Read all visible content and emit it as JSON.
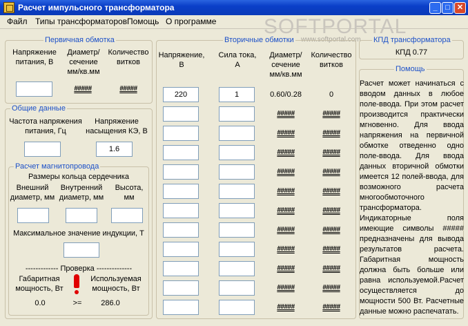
{
  "window": {
    "title": "Расчет импульсного трансформатора",
    "minimize": "_",
    "maximize": "□",
    "close": "✕"
  },
  "menu": [
    "Файл",
    "Типы трансформаторов",
    "Помощь",
    "О программе"
  ],
  "watermark": {
    "text": "SOFTPORTAL",
    "url": "www.softportal.com"
  },
  "primary": {
    "title": "Первичная обмотка",
    "col_voltage": [
      "Напряжение",
      "питания, В"
    ],
    "col_diameter": [
      "Диаметр/",
      "сечение",
      "мм/кв.мм"
    ],
    "col_turns": [
      "Количество",
      "витков"
    ],
    "voltage_value": "",
    "diameter_value": "#####",
    "turns_value": "#####"
  },
  "general": {
    "title": "Общие данные",
    "freq_label": [
      "Частота напряжения",
      "питания, Гц"
    ],
    "sat_label": [
      "Напряжение",
      "насыщения КЭ, В"
    ],
    "freq_value": "",
    "sat_value": "1.6"
  },
  "core": {
    "title": "Расчет магнитопровода",
    "ring_label": "Размеры кольца сердечника",
    "outer_label": [
      "Внешний",
      "диаметр, мм"
    ],
    "inner_label": [
      "Внутренний",
      "диаметр, мм"
    ],
    "height_label": [
      "Высота,",
      "мм"
    ],
    "outer_value": "",
    "inner_value": "",
    "height_value": "",
    "induction_label": "Максимальное значение индукции, Т",
    "induction_value": "",
    "check_label": "------------- Проверка --------------",
    "overall_label": [
      "Габаритная",
      "мощность, Вт"
    ],
    "used_label": [
      "Используемая",
      "мощность, Вт"
    ],
    "overall_value": "0.0",
    "compare_sign": ">=",
    "used_value": "286.0"
  },
  "secondary": {
    "title": "Вторичные обмотки",
    "col_voltage": [
      "Напряжение,",
      "В"
    ],
    "col_current": [
      "Сила тока,",
      "А"
    ],
    "col_diameter": [
      "Диаметр/",
      "сечение",
      "мм/кв.мм"
    ],
    "col_turns": [
      "Количество",
      "витков"
    ],
    "rows": [
      {
        "voltage": "220",
        "current": "1",
        "diameter": "0.60/0.28",
        "turns": "0"
      },
      {
        "voltage": "",
        "current": "",
        "diameter": "#####",
        "turns": "#####"
      },
      {
        "voltage": "",
        "current": "",
        "diameter": "#####",
        "turns": "#####"
      },
      {
        "voltage": "",
        "current": "",
        "diameter": "#####",
        "turns": "#####"
      },
      {
        "voltage": "",
        "current": "",
        "diameter": "#####",
        "turns": "#####"
      },
      {
        "voltage": "",
        "current": "",
        "diameter": "#####",
        "turns": "#####"
      },
      {
        "voltage": "",
        "current": "",
        "diameter": "#####",
        "turns": "#####"
      },
      {
        "voltage": "",
        "current": "",
        "diameter": "#####",
        "turns": "#####"
      },
      {
        "voltage": "",
        "current": "",
        "diameter": "#####",
        "turns": "#####"
      },
      {
        "voltage": "",
        "current": "",
        "diameter": "#####",
        "turns": "#####"
      },
      {
        "voltage": "",
        "current": "",
        "diameter": "#####",
        "turns": "#####"
      },
      {
        "voltage": "",
        "current": "",
        "diameter": "#####",
        "turns": "#####"
      }
    ]
  },
  "efficiency": {
    "title": "КПД трансформатора",
    "value": "КПД 0.77"
  },
  "help": {
    "title": "Помощь",
    "text": "Расчет может начинаться с вводом данных в любое поле-ввода. При этом расчет производится практически мгновенно. Для ввода напряжения на первичной обмотке отведенно одно поле-ввода. Для ввода данных вторичной обмотки имеется 12 полей-ввода, для возможного расчета многообмоточного трансформатора. Индикаторные поля имеющие символы ##### предназначены для вывода результатов расчета. Габаритная мощность должна быть больше или равна используемой.Расчет осуществляется до мощности 500 Вт. Расчетные данные можно распечатать."
  }
}
